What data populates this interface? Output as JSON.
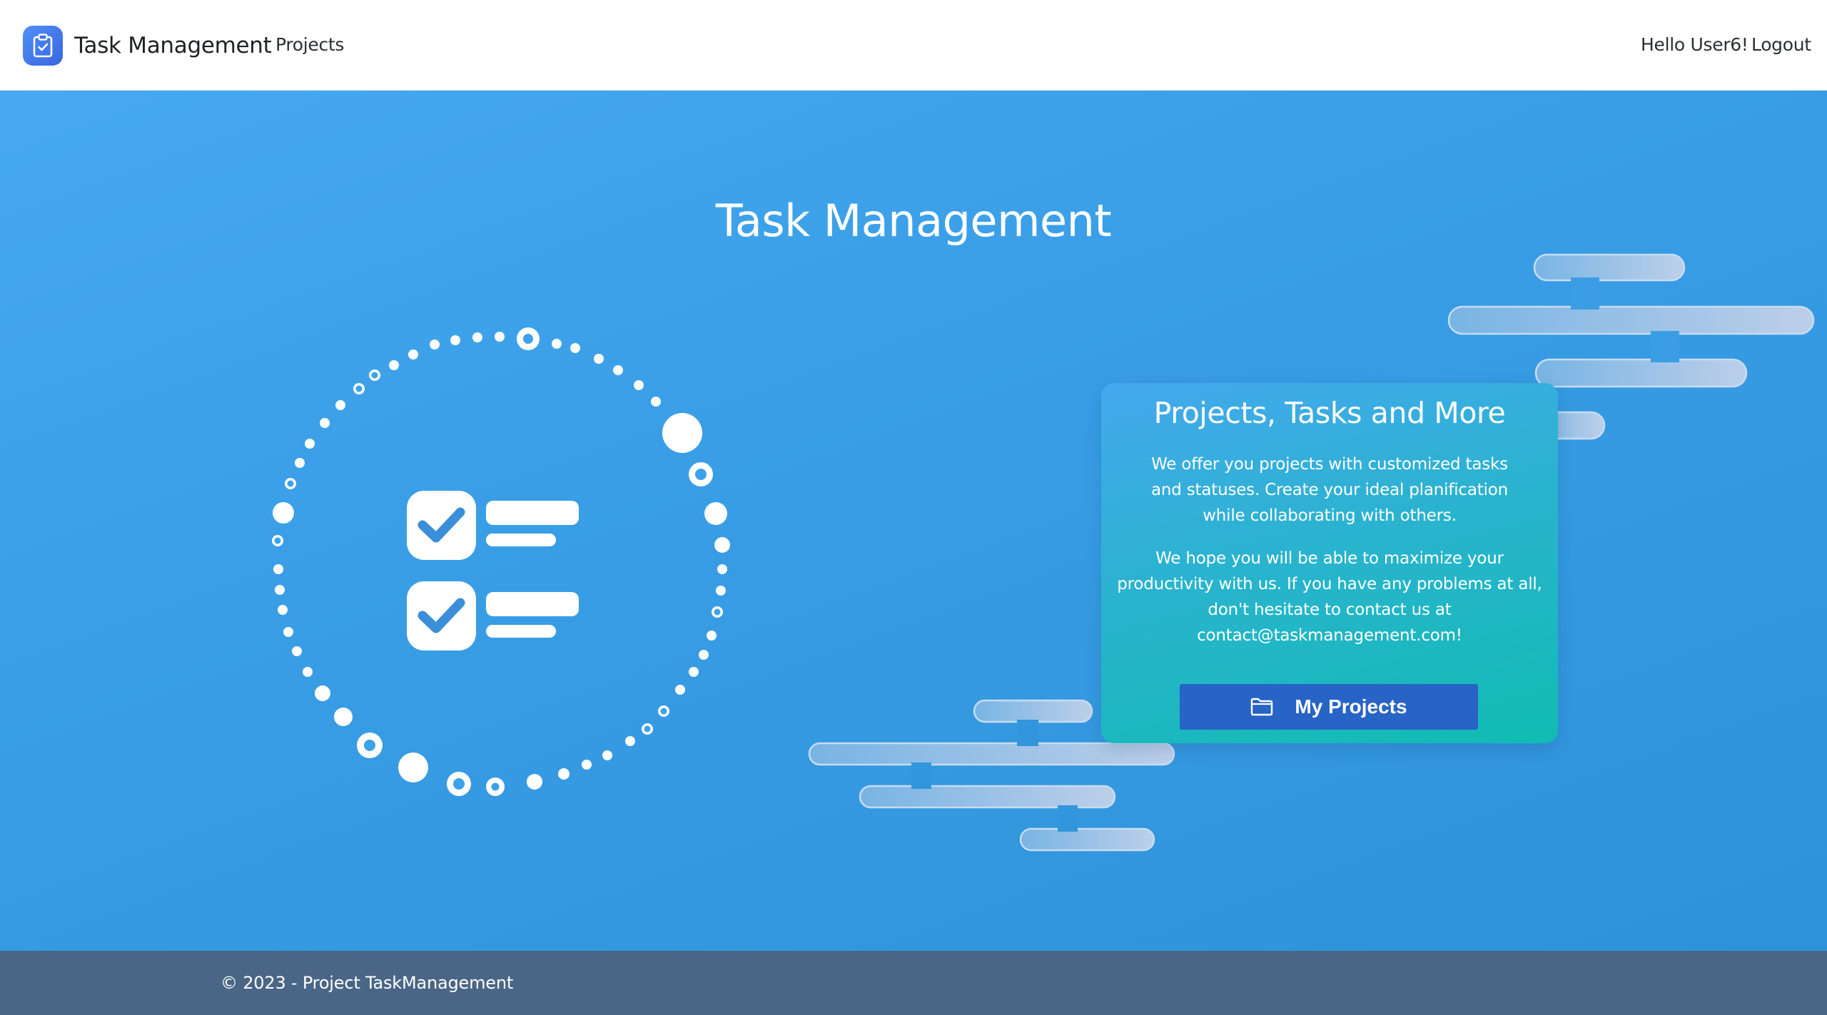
{
  "navbar": {
    "brand": "Task Management",
    "brand_icon": "clipboard-check-icon",
    "links": {
      "projects": "Projects"
    },
    "greeting": "Hello User6!",
    "logout": "Logout"
  },
  "hero": {
    "title": "Task Management",
    "illustration_icon": "checklist-icon"
  },
  "card": {
    "title": "Projects, Tasks and More",
    "paragraph1": "We offer you projects with customized tasks and statuses. Create your ideal planification while collaborating with others.",
    "paragraph2": "We hope you will be able to maximize your productivity with us. If you have any problems at all, don't hesitate to contact us at contact@taskmanagement.com!",
    "button_label": "My Projects",
    "button_icon": "folder-icon"
  },
  "footer": {
    "text": "© 2023 - Project TaskManagement"
  },
  "colors": {
    "hero_bg": "#399ee6",
    "card_gradient_start": "#45a8ef",
    "card_gradient_end": "#10bcb2",
    "button_bg": "#2863c6",
    "footer_bg": "#4a6686",
    "brand_accent": "#3a66e0"
  }
}
